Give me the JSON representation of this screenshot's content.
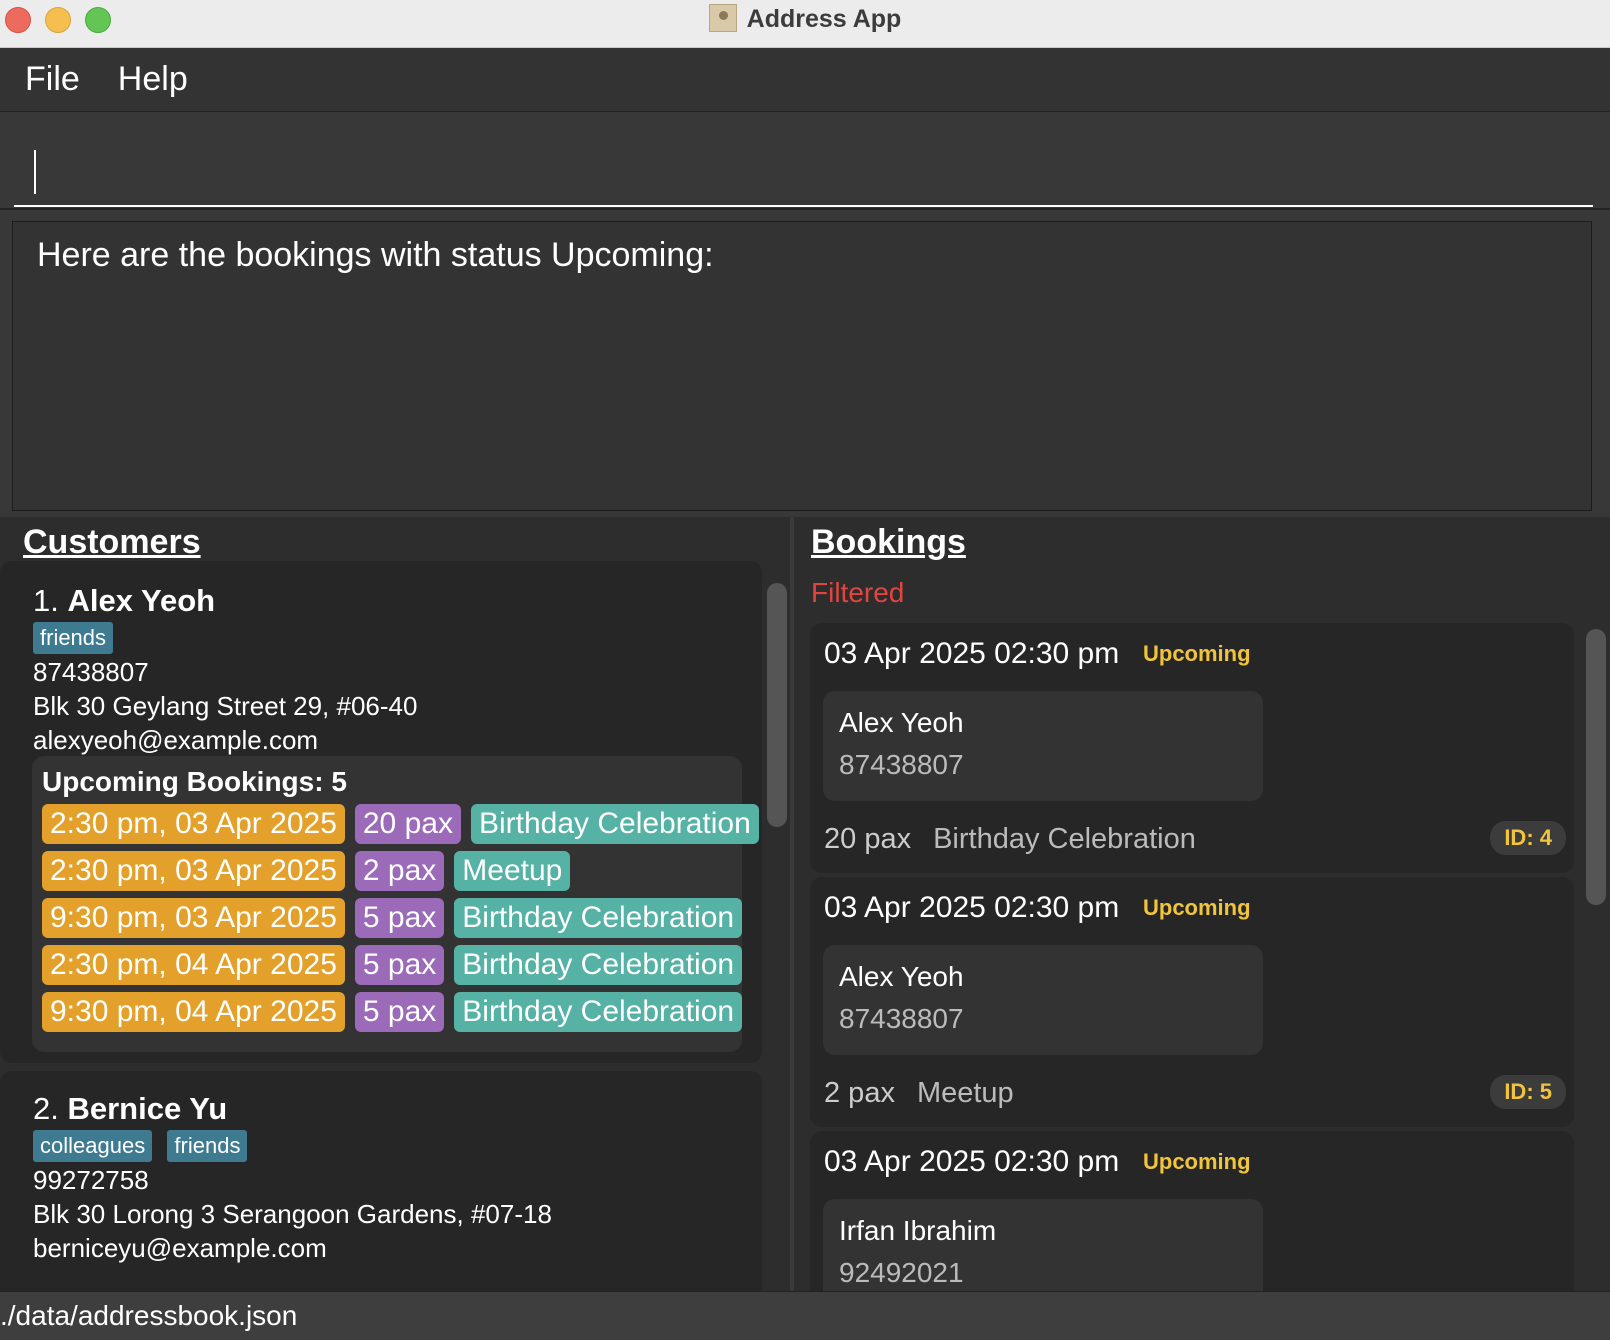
{
  "window": {
    "title": "Address App"
  },
  "menu": {
    "file": "File",
    "help": "Help"
  },
  "command": {
    "value": ""
  },
  "result": {
    "text": "Here are the bookings with status Upcoming:"
  },
  "customers": {
    "heading": "Customers",
    "items": [
      {
        "index": "1.",
        "name": "Alex Yeoh",
        "tags": [
          "friends"
        ],
        "phone": "87438807",
        "address": "Blk 30 Geylang Street 29, #06-40",
        "email": "alexyeoh@example.com",
        "upcoming_label": "Upcoming Bookings:",
        "upcoming_count": "5",
        "bookings": [
          {
            "date": "2:30 pm, 03 Apr 2025",
            "pax": "20 pax",
            "occasion": "Birthday Celebration"
          },
          {
            "date": "2:30 pm, 03 Apr 2025",
            "pax": "2 pax",
            "occasion": "Meetup"
          },
          {
            "date": "9:30 pm, 03 Apr 2025",
            "pax": "5 pax",
            "occasion": "Birthday Celebration"
          },
          {
            "date": "2:30 pm, 04 Apr 2025",
            "pax": "5 pax",
            "occasion": "Birthday Celebration"
          },
          {
            "date": "9:30 pm, 04 Apr 2025",
            "pax": "5 pax",
            "occasion": "Birthday Celebration"
          }
        ]
      },
      {
        "index": "2.",
        "name": "Bernice Yu",
        "tags": [
          "colleagues",
          "friends"
        ],
        "phone": "99272758",
        "address": "Blk 30 Lorong 3 Serangoon Gardens, #07-18",
        "email": "berniceyu@example.com"
      }
    ]
  },
  "bookings": {
    "heading": "Bookings",
    "filter_label": "Filtered",
    "items": [
      {
        "datetime": "03 Apr 2025 02:30 pm",
        "status": "Upcoming",
        "customer": "Alex Yeoh",
        "phone": "87438807",
        "pax": "20 pax",
        "occasion": "Birthday Celebration",
        "id": "ID: 4"
      },
      {
        "datetime": "03 Apr 2025 02:30 pm",
        "status": "Upcoming",
        "customer": "Alex Yeoh",
        "phone": "87438807",
        "pax": "2 pax",
        "occasion": "Meetup",
        "id": "ID: 5"
      },
      {
        "datetime": "03 Apr 2025 02:30 pm",
        "status": "Upcoming",
        "customer": "Irfan Ibrahim",
        "phone": "92492021"
      }
    ]
  },
  "status_bar": {
    "path": "./data/addressbook.json"
  },
  "colors": {
    "date_chip": "#e3a02a",
    "pax_chip": "#9b6ab8",
    "occasion_chip": "#56b2a4",
    "tag": "#3e7b91",
    "status": "#f0c43c",
    "filtered": "#e0463f"
  }
}
